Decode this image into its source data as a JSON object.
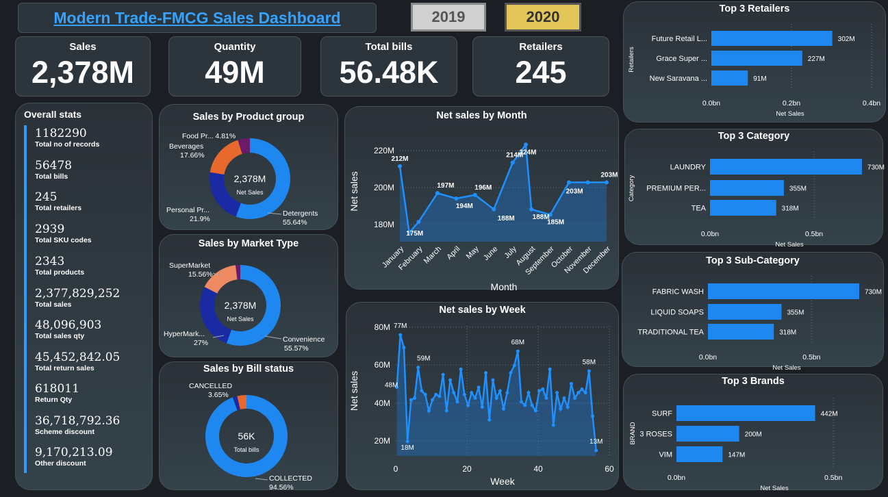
{
  "header": {
    "title": "Modern Trade-FMCG Sales Dashboard",
    "years": [
      "2019",
      "2020"
    ]
  },
  "kpis": [
    {
      "label": "Sales",
      "value": "2,378M"
    },
    {
      "label": "Quantity",
      "value": "49M"
    },
    {
      "label": "Total bills",
      "value": "56.48K"
    },
    {
      "label": "Retailers",
      "value": "245"
    }
  ],
  "overall": {
    "title": "Overall stats",
    "items": [
      {
        "value": "1182290",
        "label": "Total no of records"
      },
      {
        "value": "56478",
        "label": "Total bills"
      },
      {
        "value": "245",
        "label": "Total retailers"
      },
      {
        "value": "2939",
        "label": "Total SKU codes"
      },
      {
        "value": "2343",
        "label": "Total products"
      },
      {
        "value": "2,377,829,252",
        "label": "Total sales"
      },
      {
        "value": "48,096,903",
        "label": "Total sales qty"
      },
      {
        "value": "45,452,842.05",
        "label": "Total return sales"
      },
      {
        "value": "618011",
        "label": "Return Qty"
      },
      {
        "value": "36,718,792.36",
        "label": "Scheme discount"
      },
      {
        "value": "9,170,213.09",
        "label": "Other discount"
      }
    ]
  },
  "colors": {
    "accent": "#1e88f0",
    "navy": "#1a2aa3",
    "orange": "#e8692e",
    "salmon": "#ee8a62",
    "purple": "#6a1b6a",
    "title_link": "#33a3ff",
    "year_active": "#e3c65a"
  },
  "chart_data": [
    {
      "id": "product",
      "type": "pie",
      "title": "Sales by Product group",
      "center_value": "2,378M",
      "center_label": "Net Sales",
      "slices": [
        {
          "name": "Detergents",
          "pct": "55.64%",
          "value": 55.64,
          "color": "#1e88f0"
        },
        {
          "name": "Personal Pr...",
          "pct": "21.9%",
          "value": 21.9,
          "color": "#1a2aa3"
        },
        {
          "name": "Beverages",
          "pct": "17.66%",
          "value": 17.66,
          "color": "#e8692e"
        },
        {
          "name": "Food Pr...",
          "pct": "4.81%",
          "value": 4.81,
          "color": "#6a1b6a"
        }
      ]
    },
    {
      "id": "market",
      "type": "pie",
      "title": "Sales by Market Type",
      "center_value": "2,378M",
      "center_label": "Net Sales",
      "slices": [
        {
          "name": "Convenience",
          "pct": "55.57%",
          "value": 55.57,
          "color": "#1e88f0"
        },
        {
          "name": "HyperMark...",
          "pct": "27%",
          "value": 27,
          "color": "#1a2aa3"
        },
        {
          "name": "SuperMarket",
          "pct": "15.56%",
          "value": 15.56,
          "color": "#ee8a62"
        },
        {
          "name": "",
          "pct": "",
          "value": 1.87,
          "color": "#6a1b6a"
        }
      ]
    },
    {
      "id": "bill",
      "type": "pie",
      "title": "Sales by Bill status",
      "center_value": "56K",
      "center_label": "Total bills",
      "slices": [
        {
          "name": "COLLECTED",
          "pct": "94.56%",
          "value": 94.56,
          "color": "#1e88f0"
        },
        {
          "name": "",
          "pct": "",
          "value": 1.79,
          "color": "#1a2aa3"
        },
        {
          "name": "CANCELLED",
          "pct": "3.65%",
          "value": 3.65,
          "color": "#e8692e"
        }
      ]
    },
    {
      "id": "month",
      "type": "area",
      "title": "Net sales by Month",
      "xlabel": "Month",
      "ylabel": "Net sales",
      "ylim": [
        170,
        226
      ],
      "yticks": [
        "180M",
        "200M",
        "220M"
      ],
      "categories": [
        "January",
        "February",
        "March",
        "April",
        "May",
        "June",
        "July",
        "August",
        "September",
        "October",
        "November",
        "December"
      ],
      "x": [
        1,
        1.5,
        2,
        3,
        4,
        5,
        6,
        7,
        7.7,
        8,
        9,
        10,
        11,
        12
      ],
      "values": [
        212,
        175,
        181,
        197,
        194,
        196,
        188,
        214,
        224,
        188,
        185,
        203,
        203,
        203
      ],
      "labels": [
        "212M",
        "175M",
        "",
        "197M",
        "194M",
        "196M",
        "188M",
        "214M",
        "224M",
        "188M",
        "185M",
        "203M",
        "",
        "203M"
      ]
    },
    {
      "id": "week",
      "type": "area",
      "title": "Net sales by Week",
      "xlabel": "Week",
      "ylabel": "Net sales",
      "xlim": [
        0,
        60
      ],
      "ylim": [
        10,
        82
      ],
      "xticks": [
        "0",
        "20",
        "40",
        "60"
      ],
      "yticks": [
        "20M",
        "40M",
        "60M",
        "80M"
      ],
      "values": [
        48,
        77,
        70,
        18,
        41,
        42,
        59,
        46,
        44,
        35,
        41,
        44,
        43,
        55,
        35,
        52,
        45,
        40,
        58,
        44,
        38,
        45,
        42,
        48,
        37,
        56,
        30,
        52,
        42,
        46,
        36,
        45,
        56,
        60,
        68,
        40,
        38,
        45,
        38,
        35,
        46,
        47,
        42,
        58,
        27,
        45,
        36,
        42,
        37,
        50,
        42,
        45,
        47,
        45,
        57,
        32,
        13
      ],
      "labels": [
        {
          "i": 0,
          "t": "48M"
        },
        {
          "i": 1,
          "t": "77M"
        },
        {
          "i": 3,
          "t": "18M"
        },
        {
          "i": 6,
          "t": "59M"
        },
        {
          "i": 34,
          "t": "68M"
        },
        {
          "i": 54,
          "t": "58M"
        },
        {
          "i": 56,
          "t": "13M"
        }
      ]
    },
    {
      "id": "retailers",
      "type": "bar",
      "title": "Top 3 Retailers",
      "xlabel": "Net Sales",
      "ylabel": "Retailers",
      "xlim": [
        0,
        0.4
      ],
      "xticks": [
        "0.0bn",
        "0.2bn",
        "0.4bn"
      ],
      "categories": [
        "Future Retail L...",
        "Grace Super ...",
        "New Saravana ..."
      ],
      "values": [
        0.302,
        0.227,
        0.091
      ],
      "labels": [
        "302M",
        "227M",
        "91M"
      ]
    },
    {
      "id": "category",
      "type": "bar",
      "title": "Top 3 Category",
      "xlabel": "Net Sales",
      "ylabel": "Category",
      "xlim": [
        0,
        0.75
      ],
      "xticks": [
        "0.0bn",
        "0.5bn"
      ],
      "categories": [
        "LAUNDRY",
        "PREMIUM PER...",
        "TEA"
      ],
      "values": [
        0.73,
        0.355,
        0.318
      ],
      "labels": [
        "730M",
        "355M",
        "318M"
      ]
    },
    {
      "id": "subcategory",
      "type": "bar",
      "title": "Top 3 Sub-Category",
      "xlabel": "Net Sales",
      "ylabel": "",
      "xlim": [
        0,
        0.75
      ],
      "xticks": [
        "0.0bn",
        "0.5bn"
      ],
      "categories": [
        "FABRIC WASH",
        "LIQUID SOAPS",
        "TRADITIONAL TEA"
      ],
      "values": [
        0.73,
        0.355,
        0.318
      ],
      "labels": [
        "730M",
        "355M",
        "318M"
      ]
    },
    {
      "id": "brands",
      "type": "bar",
      "title": "Top 3 Brands",
      "xlabel": "Net Sales",
      "ylabel": "BRAND",
      "xlim": [
        0,
        0.6
      ],
      "xticks": [
        "0.0bn",
        "0.5bn"
      ],
      "categories": [
        "SURF",
        "3 ROSES",
        "VIM"
      ],
      "values": [
        0.442,
        0.2,
        0.147
      ],
      "labels": [
        "442M",
        "200M",
        "147M"
      ]
    }
  ]
}
